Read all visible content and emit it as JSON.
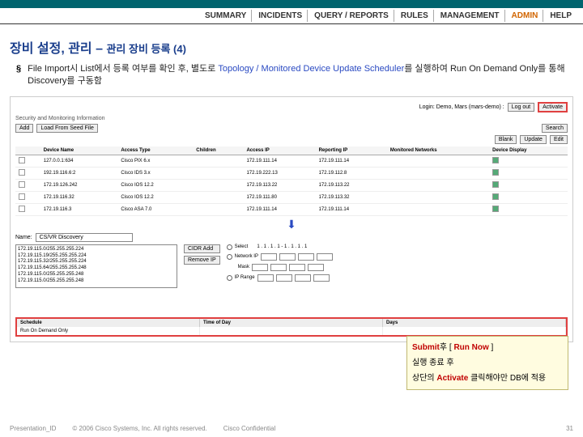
{
  "nav": [
    "SUMMARY",
    "INCIDENTS",
    "QUERY / REPORTS",
    "RULES",
    "MANAGEMENT",
    "ADMIN",
    "HELP"
  ],
  "headline": {
    "main": "장비 설정, 관리 – ",
    "sub": "관리 장비 등록 (4)"
  },
  "bullet": {
    "pre": "File Import시 List에서 등록 여부를 확인 후, 별도로 ",
    "blue": "Topology / Monitored Device Update Scheduler",
    "mid": "를 실행하여 Run On Demand Only를 통해 ",
    "disc": "Discovery",
    "post": "를 구동함"
  },
  "login": {
    "label": "Login: Demo, Mars (mars-demo) :",
    "btn1": "Log out",
    "btn2": "Activate"
  },
  "section": "Security and Monitoring Information",
  "toolbar": {
    "add": "Add",
    "load": "Load From Seed File",
    "th": [
      "Blank",
      "Update",
      "Edit"
    ]
  },
  "search": "Search",
  "table": {
    "headers": [
      "",
      "Device Name",
      "Access Type",
      "Children",
      "Access IP",
      "Reporting IP",
      "Monitored Networks",
      "Device Display"
    ],
    "rows": [
      [
        "",
        "127.0.0.1:634",
        "Cisco PIX 6.x",
        "",
        "172.19.111.14",
        "172.19.111.14",
        "",
        ""
      ],
      [
        "",
        "192.19.116.6:2",
        "Cisco IDS 3.x",
        "",
        "172.19.222.13",
        "172.19.112.8",
        "",
        ""
      ],
      [
        "",
        "172.19.126.242",
        "Cisco IOS 12.2",
        "",
        "172.19.113.22",
        "172.19.113.22",
        "",
        ""
      ],
      [
        "",
        "172.19.116.32",
        "Cisco IOS 12.2",
        "",
        "172.19.111.80",
        "172.19.113.32",
        "",
        ""
      ],
      [
        "",
        "172.19.116.3",
        "Cisco ASA 7.0",
        "",
        "172.19.111.14",
        "172.19.111.14",
        "",
        ""
      ]
    ]
  },
  "nameLabel": "Name:",
  "nameValue": "CS/VR Discovery",
  "ipList": [
    "172.19.115.0/255.255.255.224",
    "172.19.115.19/255.255.255.224",
    "172.19.115.32/255.255.255.224",
    "172.19.115.64/255.255.255.248",
    "172.19.115.0/255.255.255.248",
    "172.19.115.0/255.255.255.248"
  ],
  "midBtns": {
    "add": "CIDR Add",
    "remove": "Remove IP"
  },
  "radios": {
    "r1": "Select",
    "r2": "Network IP",
    "r3": "Mask",
    "r4": "IP Range"
  },
  "rangeInit": "1 . 1 . 1 . 1 - 1 . 1 . 1 . 1",
  "arrow": "⬇",
  "callout": {
    "l1a": "Submit",
    "l1b": "후 [ ",
    "l1c": "Run Now",
    "l1d": " ]",
    "l2": "실행 종료 후",
    "l3a": "상단의 ",
    "l3b": "Activate",
    "l3c": " 클릭해야만 DB에 적용"
  },
  "sched": {
    "hdr": [
      "Schedule",
      "Time of Day",
      "Days"
    ],
    "row": [
      "Run On Demand Only",
      "",
      ""
    ]
  },
  "footer": {
    "pid": "Presentation_ID",
    "copy": "© 2006 Cisco Systems, Inc. All rights reserved.",
    "conf": "Cisco Confidential",
    "page": "31"
  }
}
